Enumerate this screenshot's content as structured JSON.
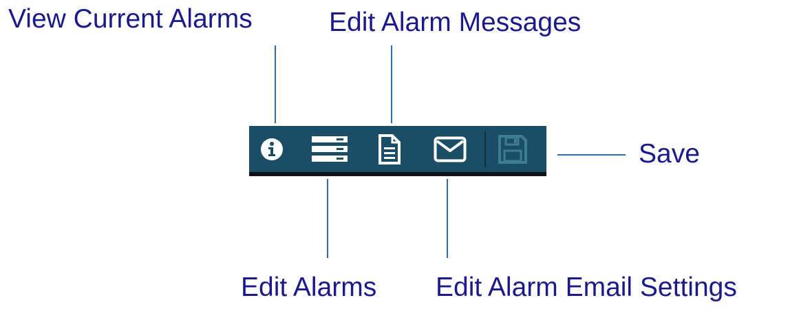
{
  "callouts": {
    "view_current_alarms": "View Current Alarms",
    "edit_alarm_messages": "Edit Alarm Messages",
    "edit_alarms": "Edit Alarms",
    "edit_alarm_email_settings": "Edit Alarm Email Settings",
    "save": "Save"
  },
  "toolbar": {
    "buttons": [
      {
        "icon": "info-circle-icon",
        "enabled": true
      },
      {
        "icon": "server-stack-icon",
        "enabled": true
      },
      {
        "icon": "document-icon",
        "enabled": true
      },
      {
        "icon": "envelope-icon",
        "enabled": true
      },
      {
        "icon": "floppy-disk-icon",
        "enabled": false
      }
    ]
  },
  "colors": {
    "toolbar_background": "#1b4e66",
    "toolbar_bottom_border": "#101418",
    "icon_enabled": "#ffffff",
    "icon_disabled": "#3d7d90",
    "label_text": "#1a1a8c",
    "leader_line": "#2f6db3"
  }
}
